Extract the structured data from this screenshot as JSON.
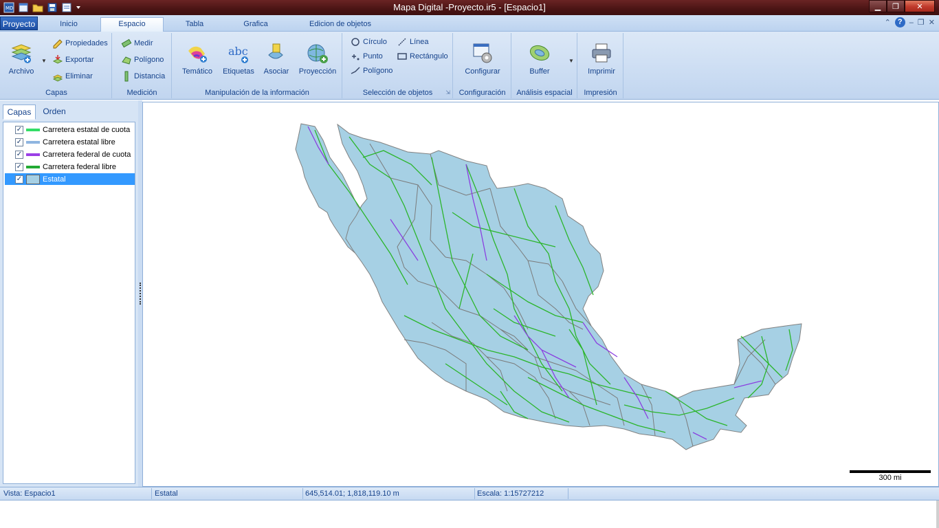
{
  "window": {
    "title": "Mapa Digital -Proyecto.ir5 - [Espacio1]"
  },
  "ribbon_tabs": {
    "app": "Proyecto",
    "inicio": "Inicio",
    "espacio": "Espacio",
    "tabla": "Tabla",
    "grafica": "Grafica",
    "edicion": "Edicion de objetos"
  },
  "ribbon": {
    "capas": {
      "label": "Capas",
      "archivo": "Archivo",
      "propiedades": "Propiedades",
      "exportar": "Exportar",
      "eliminar": "Eliminar"
    },
    "medicion": {
      "label": "Medición",
      "medir": "Medir",
      "poligono": "Polígono",
      "distancia": "Distancia"
    },
    "manipulacion": {
      "label": "Manipulación de la información",
      "tematico": "Temático",
      "etiquetas": "Etiquetas",
      "asociar": "Asociar",
      "proyeccion": "Proyección"
    },
    "seleccion": {
      "label": "Selección de objetos",
      "circulo": "Círculo",
      "linea": "Línea",
      "punto": "Punto",
      "rectangulo": "Rectángulo",
      "poligono": "Polígono"
    },
    "configuracion": {
      "label": "Configuración",
      "configurar": "Configurar"
    },
    "analisis": {
      "label": "Análisis espacial",
      "buffer": "Buffer"
    },
    "impresion": {
      "label": "Impresión",
      "imprimir": "Imprimir"
    }
  },
  "left_panel": {
    "tabs": [
      "Capas",
      "Orden"
    ],
    "layers": [
      {
        "name": "Carretera estatal de cuota",
        "color": "#33dd66",
        "checked": true
      },
      {
        "name": "Carretera estatal libre",
        "color": "#8fb5e0",
        "checked": true
      },
      {
        "name": "Carretera federal de cuota",
        "color": "#9b3fe6",
        "checked": true
      },
      {
        "name": "Carretera federal libre",
        "color": "#22aa33",
        "checked": true
      },
      {
        "name": "Estatal",
        "color": "#a6d0e4",
        "checked": true,
        "selected": true
      }
    ]
  },
  "map": {
    "fill_color": "#a6d0e4",
    "border_color": "#808080",
    "road_green": "#2bb52b",
    "road_purple": "#8a3fe0",
    "scale_label": "300 mi"
  },
  "status": {
    "vista": "Vista: Espacio1",
    "layer": "Estatal",
    "coords": "645,514.01; 1,818,119.10 m",
    "escala": "Escala: 1:15727212"
  }
}
